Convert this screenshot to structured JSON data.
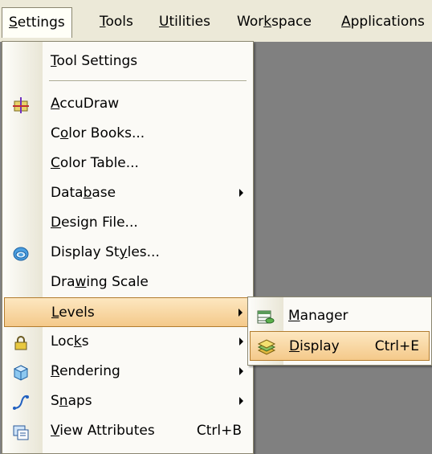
{
  "menubar": {
    "items": [
      {
        "label": "Settings",
        "mnemonic": "S",
        "rest": "ettings"
      },
      {
        "label": "Tools",
        "mnemonic": "T",
        "rest": "ools"
      },
      {
        "label": "Utilities",
        "mnemonic": "U",
        "rest": "tilities"
      },
      {
        "pre": "Wor",
        "mnemonic": "k",
        "rest": "space",
        "label": "Workspace"
      },
      {
        "label": "Applications",
        "mnemonic": "A",
        "rest": "pplications"
      }
    ]
  },
  "settings_menu": {
    "items": [
      {
        "pre": "",
        "mnemonic": "T",
        "rest": "ool Settings",
        "label": "Tool Settings"
      },
      {
        "pre": "",
        "mnemonic": "A",
        "rest": "ccuDraw",
        "label": "AccuDraw",
        "icon": "accudraw-icon"
      },
      {
        "pre": "C",
        "mnemonic": "o",
        "rest": "lor Books...",
        "label": "Color Books..."
      },
      {
        "pre": "",
        "mnemonic": "C",
        "rest": "olor Table...",
        "label": "Color Table..."
      },
      {
        "pre": "Data",
        "mnemonic": "b",
        "rest": "ase",
        "label": "Database",
        "submenu": true
      },
      {
        "pre": "",
        "mnemonic": "D",
        "rest": "esign File...",
        "label": "Design File..."
      },
      {
        "pre": "Display St",
        "mnemonic": "y",
        "rest": "les...",
        "label": "Display Styles...",
        "icon": "display-styles-icon"
      },
      {
        "pre": "Dra",
        "mnemonic": "w",
        "rest": "ing Scale",
        "label": "Drawing Scale"
      },
      {
        "pre": "",
        "mnemonic": "L",
        "rest": "evels",
        "label": "Levels",
        "submenu": true
      },
      {
        "pre": "Loc",
        "mnemonic": "k",
        "rest": "s",
        "label": "Locks",
        "submenu": true,
        "icon": "lock-icon"
      },
      {
        "pre": "",
        "mnemonic": "R",
        "rest": "endering",
        "label": "Rendering",
        "submenu": true,
        "icon": "rendering-icon"
      },
      {
        "pre": "S",
        "mnemonic": "n",
        "rest": "aps",
        "label": "Snaps",
        "submenu": true,
        "icon": "snaps-icon"
      },
      {
        "pre": "",
        "mnemonic": "V",
        "rest": "iew Attributes",
        "label": "View Attributes",
        "shortcut": "Ctrl+B",
        "icon": "view-attributes-icon"
      }
    ]
  },
  "levels_submenu": {
    "items": [
      {
        "pre": "",
        "mnemonic": "M",
        "rest": "anager",
        "label": "Manager",
        "icon": "level-manager-icon"
      },
      {
        "pre": "",
        "mnemonic": "D",
        "rest": "isplay",
        "label": "Display",
        "shortcut": "Ctrl+E",
        "icon": "level-display-icon"
      }
    ]
  },
  "colors": {
    "highlight": "#f8d7a1",
    "highlight_border": "#b27c2e",
    "menu_bg": "#fbfaf6",
    "workspace": "#808080"
  }
}
